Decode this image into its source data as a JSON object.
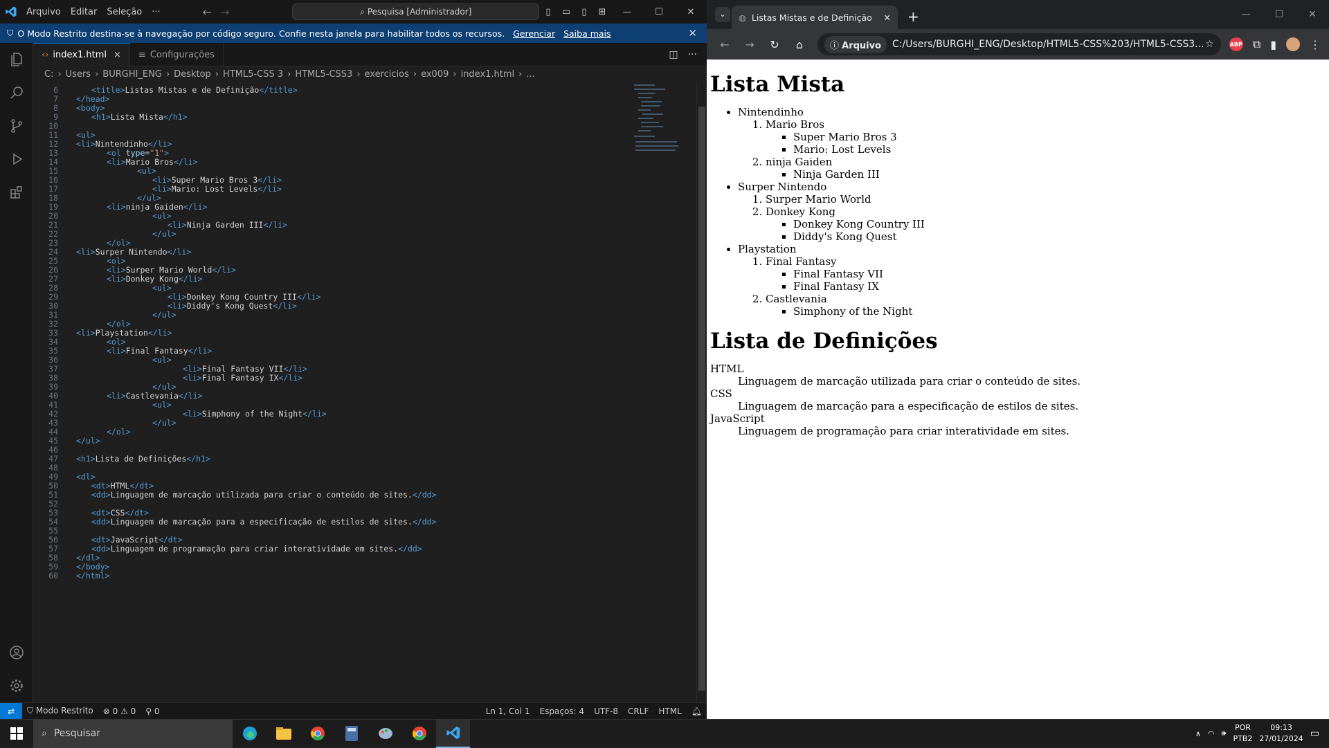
{
  "vscode": {
    "menu": [
      "Arquivo",
      "Editar",
      "Seleção",
      "···"
    ],
    "search": "Pesquisa [Administrador]",
    "banner": {
      "text": "O Modo Restrito destina-se à navegação por código seguro. Confie nesta janela para habilitar todos os recursos.",
      "manage": "Gerenciar",
      "learn": "Saiba mais"
    },
    "tabs": [
      {
        "label": "index1.html",
        "close": "×"
      },
      {
        "label": "Configurações"
      }
    ],
    "breadcrumb": [
      "C:",
      "Users",
      "BURGHI_ENG",
      "Desktop",
      "HTML5-CSS 3",
      "HTML5-CSS3",
      "exercicios",
      "ex009",
      "index1.html",
      "..."
    ],
    "status": {
      "mode": "Modo Restrito",
      "errors": "0",
      "warnings": "0",
      "ports": "0",
      "position": "Ln 1, Col 1",
      "spaces": "Espaços: 4",
      "encoding": "UTF-8",
      "eol": "CRLF",
      "lang": "HTML"
    }
  },
  "code_lines": [
    {
      "n": "6",
      "i": 1,
      "tokens": [
        [
          "t",
          "<title>"
        ],
        [
          "x",
          "Listas Mistas e de Definição"
        ],
        [
          "t",
          "</title>"
        ]
      ]
    },
    {
      "n": "7",
      "i": 0,
      "tokens": [
        [
          "t",
          "</head>"
        ]
      ]
    },
    {
      "n": "8",
      "i": 0,
      "tokens": [
        [
          "t",
          "<body>"
        ]
      ]
    },
    {
      "n": "9",
      "i": 1,
      "tokens": [
        [
          "t",
          "<h1>"
        ],
        [
          "x",
          "Lista Mista"
        ],
        [
          "t",
          "</h1>"
        ]
      ]
    },
    {
      "n": "10",
      "i": 0,
      "tokens": []
    },
    {
      "n": "11",
      "i": 0,
      "tokens": [
        [
          "t",
          "<ul>"
        ]
      ]
    },
    {
      "n": "12",
      "i": 0,
      "tokens": [
        [
          "t",
          "<li>"
        ],
        [
          "x",
          "Nintendinho"
        ],
        [
          "t",
          "</li>"
        ]
      ]
    },
    {
      "n": "13",
      "i": 2,
      "tokens": [
        [
          "t",
          "<ol "
        ],
        [
          "a",
          "type"
        ],
        [
          "x",
          "="
        ],
        [
          "s",
          "\"1\""
        ],
        [
          "t",
          ">"
        ]
      ]
    },
    {
      "n": "14",
      "i": 2,
      "tokens": [
        [
          "t",
          "<li>"
        ],
        [
          "x",
          "Mario Bros"
        ],
        [
          "t",
          "</li>"
        ]
      ]
    },
    {
      "n": "15",
      "i": 4,
      "tokens": [
        [
          "t",
          "<ul>"
        ]
      ]
    },
    {
      "n": "16",
      "i": 5,
      "tokens": [
        [
          "t",
          "<li>"
        ],
        [
          "x",
          "Super Mario Bros 3"
        ],
        [
          "t",
          "</li>"
        ]
      ]
    },
    {
      "n": "17",
      "i": 5,
      "tokens": [
        [
          "t",
          "<li>"
        ],
        [
          "x",
          "Mario: Lost Levels"
        ],
        [
          "t",
          "</li>"
        ]
      ]
    },
    {
      "n": "18",
      "i": 4,
      "tokens": [
        [
          "t",
          "</ul>"
        ]
      ]
    },
    {
      "n": "19",
      "i": 2,
      "tokens": [
        [
          "t",
          "<li>"
        ],
        [
          "x",
          "ninja Gaiden"
        ],
        [
          "t",
          "</li>"
        ]
      ]
    },
    {
      "n": "20",
      "i": 5,
      "tokens": [
        [
          "t",
          "<ul>"
        ]
      ]
    },
    {
      "n": "21",
      "i": 6,
      "tokens": [
        [
          "t",
          "<li>"
        ],
        [
          "x",
          "Ninja Garden III"
        ],
        [
          "t",
          "</li>"
        ]
      ]
    },
    {
      "n": "22",
      "i": 5,
      "tokens": [
        [
          "t",
          "</ul>"
        ]
      ]
    },
    {
      "n": "23",
      "i": 2,
      "tokens": [
        [
          "t",
          "</ol>"
        ]
      ]
    },
    {
      "n": "24",
      "i": 0,
      "tokens": [
        [
          "t",
          "<li>"
        ],
        [
          "x",
          "Surper Nintendo"
        ],
        [
          "t",
          "</li>"
        ]
      ]
    },
    {
      "n": "25",
      "i": 2,
      "tokens": [
        [
          "t",
          "<ol>"
        ]
      ]
    },
    {
      "n": "26",
      "i": 2,
      "tokens": [
        [
          "t",
          "<li>"
        ],
        [
          "x",
          "Surper Mario World"
        ],
        [
          "t",
          "</li>"
        ]
      ]
    },
    {
      "n": "27",
      "i": 2,
      "tokens": [
        [
          "t",
          "<li>"
        ],
        [
          "x",
          "Donkey Kong"
        ],
        [
          "t",
          "</li>"
        ]
      ]
    },
    {
      "n": "28",
      "i": 5,
      "tokens": [
        [
          "t",
          "<ul>"
        ]
      ]
    },
    {
      "n": "29",
      "i": 6,
      "tokens": [
        [
          "t",
          "<li>"
        ],
        [
          "x",
          "Donkey Kong Country III"
        ],
        [
          "t",
          "</li>"
        ]
      ]
    },
    {
      "n": "30",
      "i": 6,
      "tokens": [
        [
          "t",
          "<li>"
        ],
        [
          "x",
          "Diddy's Kong Quest"
        ],
        [
          "t",
          "</li>"
        ]
      ]
    },
    {
      "n": "31",
      "i": 5,
      "tokens": [
        [
          "t",
          "</ul>"
        ]
      ]
    },
    {
      "n": "32",
      "i": 2,
      "tokens": [
        [
          "t",
          "</ol>"
        ]
      ]
    },
    {
      "n": "33",
      "i": 0,
      "tokens": [
        [
          "t",
          "<li>"
        ],
        [
          "x",
          "Playstation"
        ],
        [
          "t",
          "</li>"
        ]
      ]
    },
    {
      "n": "34",
      "i": 2,
      "tokens": [
        [
          "t",
          "<ol>"
        ]
      ]
    },
    {
      "n": "35",
      "i": 2,
      "tokens": [
        [
          "t",
          "<li>"
        ],
        [
          "x",
          "Final Fantasy"
        ],
        [
          "t",
          "</li>"
        ]
      ]
    },
    {
      "n": "36",
      "i": 5,
      "tokens": [
        [
          "t",
          "<ul>"
        ]
      ]
    },
    {
      "n": "37",
      "i": 7,
      "tokens": [
        [
          "t",
          "<li>"
        ],
        [
          "x",
          "Final Fantasy VII"
        ],
        [
          "t",
          "</li>"
        ]
      ]
    },
    {
      "n": "38",
      "i": 7,
      "tokens": [
        [
          "t",
          "<li>"
        ],
        [
          "x",
          "Final Fantasy IX"
        ],
        [
          "t",
          "</li>"
        ]
      ]
    },
    {
      "n": "39",
      "i": 5,
      "tokens": [
        [
          "t",
          "</ul>"
        ]
      ]
    },
    {
      "n": "40",
      "i": 2,
      "tokens": [
        [
          "t",
          "<li>"
        ],
        [
          "x",
          "Castlevania"
        ],
        [
          "t",
          "</li>"
        ]
      ]
    },
    {
      "n": "41",
      "i": 5,
      "tokens": [
        [
          "t",
          "<ul>"
        ]
      ]
    },
    {
      "n": "42",
      "i": 7,
      "tokens": [
        [
          "t",
          "<li>"
        ],
        [
          "x",
          "Simphony of the Night"
        ],
        [
          "t",
          "</li>"
        ]
      ]
    },
    {
      "n": "43",
      "i": 5,
      "tokens": [
        [
          "t",
          "</ul>"
        ]
      ]
    },
    {
      "n": "44",
      "i": 2,
      "tokens": [
        [
          "t",
          "</ol>"
        ]
      ]
    },
    {
      "n": "45",
      "i": 0,
      "tokens": [
        [
          "t",
          "</ul>"
        ]
      ]
    },
    {
      "n": "46",
      "i": 0,
      "tokens": []
    },
    {
      "n": "47",
      "i": 0,
      "tokens": [
        [
          "t",
          "<h1>"
        ],
        [
          "x",
          "Lista de Definições"
        ],
        [
          "t",
          "</h1>"
        ]
      ]
    },
    {
      "n": "48",
      "i": 0,
      "tokens": []
    },
    {
      "n": "49",
      "i": 0,
      "tokens": [
        [
          "t",
          "<dl>"
        ]
      ]
    },
    {
      "n": "50",
      "i": 1,
      "tokens": [
        [
          "t",
          "<dt>"
        ],
        [
          "x",
          "HTML"
        ],
        [
          "t",
          "</dt>"
        ]
      ]
    },
    {
      "n": "51",
      "i": 1,
      "tokens": [
        [
          "t",
          "<dd>"
        ],
        [
          "x",
          "Linguagem de marcação utilizada para criar o conteúdo de sites."
        ],
        [
          "t",
          "</dd>"
        ]
      ]
    },
    {
      "n": "52",
      "i": 0,
      "tokens": []
    },
    {
      "n": "53",
      "i": 1,
      "tokens": [
        [
          "t",
          "<dt>"
        ],
        [
          "x",
          "CSS"
        ],
        [
          "t",
          "</dt>"
        ]
      ]
    },
    {
      "n": "54",
      "i": 1,
      "tokens": [
        [
          "t",
          "<dd>"
        ],
        [
          "x",
          "Linguagem de marcação para a especificação de estilos de sites."
        ],
        [
          "t",
          "</dd>"
        ]
      ]
    },
    {
      "n": "55",
      "i": 0,
      "tokens": []
    },
    {
      "n": "56",
      "i": 1,
      "tokens": [
        [
          "t",
          "<dt>"
        ],
        [
          "x",
          "JavaScript"
        ],
        [
          "t",
          "</dt>"
        ]
      ]
    },
    {
      "n": "57",
      "i": 1,
      "tokens": [
        [
          "t",
          "<dd>"
        ],
        [
          "x",
          "Linguagem de programação para criar interatividade em sites."
        ],
        [
          "t",
          "</dd>"
        ]
      ]
    },
    {
      "n": "58",
      "i": 0,
      "tokens": [
        [
          "t",
          "</dl>"
        ]
      ]
    },
    {
      "n": "59",
      "i": 0,
      "tokens": [
        [
          "t",
          "</body>"
        ]
      ]
    },
    {
      "n": "60",
      "i": 0,
      "tokens": [
        [
          "t",
          "</html>"
        ]
      ]
    }
  ],
  "browser": {
    "tab_title": "Listas Mistas e de Definição",
    "url_chip": "Arquivo",
    "url": "C:/Users/BURGHI_ENG/Desktop/HTML5-CSS%203/HTML5-CSS3...",
    "abp": "ABP"
  },
  "page": {
    "h1_mixed": "Lista Mista",
    "tree": [
      {
        "label": "Nintendinho",
        "children": [
          {
            "label": "Mario Bros",
            "items": [
              "Super Mario Bros 3",
              "Mario: Lost Levels"
            ]
          },
          {
            "label": "ninja Gaiden",
            "items": [
              "Ninja Garden III"
            ]
          }
        ]
      },
      {
        "label": "Surper Nintendo",
        "children": [
          {
            "label": "Surper Mario World",
            "items": []
          },
          {
            "label": "Donkey Kong",
            "items": [
              "Donkey Kong Country III",
              "Diddy's Kong Quest"
            ]
          }
        ]
      },
      {
        "label": "Playstation",
        "children": [
          {
            "label": "Final Fantasy",
            "items": [
              "Final Fantasy VII",
              "Final Fantasy IX"
            ]
          },
          {
            "label": "Castlevania",
            "items": [
              "Simphony of the Night"
            ]
          }
        ]
      }
    ],
    "h1_def": "Lista de Definições",
    "definitions": [
      {
        "term": "HTML",
        "desc": "Linguagem de marcação utilizada para criar o conteúdo de sites."
      },
      {
        "term": "CSS",
        "desc": "Linguagem de marcação para a especificação de estilos de sites."
      },
      {
        "term": "JavaScript",
        "desc": "Linguagem de programação para criar interatividade em sites."
      }
    ]
  },
  "taskbar": {
    "search": "Pesquisar",
    "lang1": "POR",
    "lang2": "PTB2",
    "time": "09:13",
    "date": "27/01/2024"
  },
  "colors": {
    "accent": "#0078d4",
    "banner": "#0e3f73",
    "tag": "#569cd6",
    "string": "#ce9178",
    "attr": "#9cdcfe"
  }
}
